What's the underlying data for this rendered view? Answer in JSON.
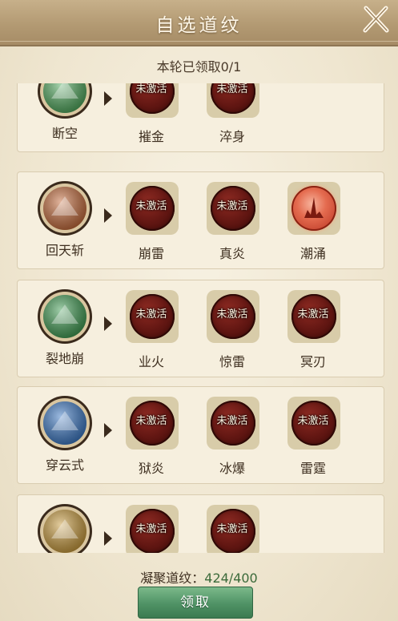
{
  "header": {
    "title": "自选道纹",
    "close_icon": "close-x-icon"
  },
  "claim_status": "本轮已领取0/1",
  "rows": [
    {
      "skill": {
        "name": "断空",
        "icon": "blade-green-icon",
        "color": "#4fa85c"
      },
      "slots": [
        {
          "name": "摧金",
          "label": "未激活",
          "active": false
        },
        {
          "name": "淬身",
          "label": "未激活",
          "active": false
        }
      ]
    },
    {
      "skill": {
        "name": "回天斩",
        "icon": "spiral-orange-icon",
        "color": "#c46a3a"
      },
      "slots": [
        {
          "name": "崩雷",
          "label": "未激活",
          "active": false
        },
        {
          "name": "真炎",
          "label": "未激活",
          "active": false
        },
        {
          "name": "潮涌",
          "label": "",
          "active": true
        }
      ]
    },
    {
      "skill": {
        "name": "裂地崩",
        "icon": "spikes-green-icon",
        "color": "#3f9b52"
      },
      "slots": [
        {
          "name": "业火",
          "label": "未激活",
          "active": false
        },
        {
          "name": "惊雷",
          "label": "未激活",
          "active": false
        },
        {
          "name": "冥刃",
          "label": "未激活",
          "active": false
        }
      ]
    },
    {
      "skill": {
        "name": "穿云式",
        "icon": "lightning-blue-icon",
        "color": "#3b78c4"
      },
      "slots": [
        {
          "name": "狱炎",
          "label": "未激活",
          "active": false
        },
        {
          "name": "冰爆",
          "label": "未激活",
          "active": false
        },
        {
          "name": "雷霆",
          "label": "未激活",
          "active": false
        }
      ]
    },
    {
      "skill": {
        "name": "",
        "icon": "beast-gold-icon",
        "color": "#c89a3c"
      },
      "slots": [
        {
          "name": "",
          "label": "未激活",
          "active": false
        },
        {
          "name": "",
          "label": "未激活",
          "active": false
        }
      ]
    }
  ],
  "footer": {
    "total_label": "凝聚道纹：",
    "total_value": "424/400",
    "claim_button": "领取"
  }
}
